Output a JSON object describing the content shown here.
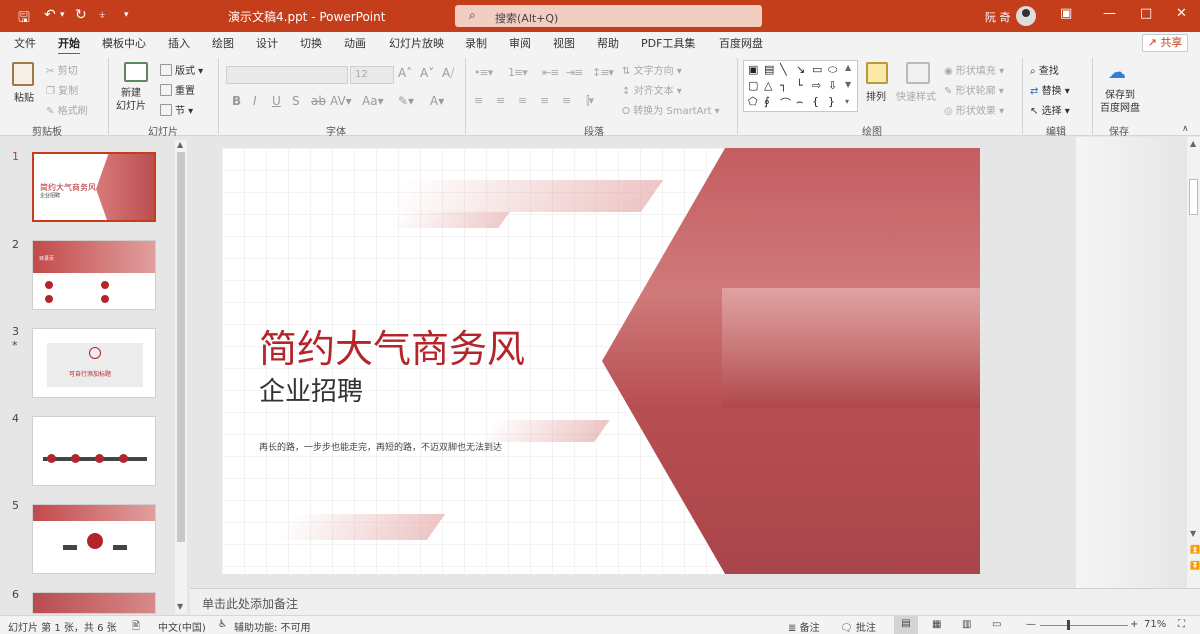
{
  "titlebar": {
    "doc_title": "演示文稿4.ppt - PowerPoint",
    "search_placeholder": "搜索(Alt+Q)",
    "user_name": "阮 奇",
    "accent": "#c43e1c"
  },
  "menu": {
    "tabs": [
      "文件",
      "开始",
      "模板中心",
      "插入",
      "绘图",
      "设计",
      "切换",
      "动画",
      "幻灯片放映",
      "录制",
      "审阅",
      "视图",
      "帮助",
      "PDF工具集",
      "百度网盘"
    ],
    "active": "开始",
    "share": "共享"
  },
  "ribbon": {
    "clipboard": {
      "label": "剪贴板",
      "paste": "粘贴",
      "cut": "剪切",
      "copy": "复制",
      "format_painter": "格式刷"
    },
    "slides": {
      "label": "幻灯片",
      "new_slide": "新建\n幻灯片",
      "layout": "版式",
      "reset": "重置",
      "section": "节"
    },
    "font": {
      "label": "字体",
      "size": "12"
    },
    "paragraph": {
      "label": "段落",
      "text_direction": "文字方向",
      "align_text": "对齐文本",
      "smartart": "转换为 SmartArt"
    },
    "drawing": {
      "label": "绘图",
      "arrange": "排列",
      "quick_styles": "快速样式",
      "shape_fill": "形状填充",
      "shape_outline": "形状轮廓",
      "shape_effects": "形状效果"
    },
    "editing": {
      "label": "编辑",
      "find": "查找",
      "replace": "替换",
      "select": "选择"
    },
    "save": {
      "label": "保存",
      "save_to_baidu": "保存到\n百度网盘"
    }
  },
  "thumbnails": [
    {
      "num": "1",
      "title": "简约大气商务风",
      "subtitle": "企业招聘"
    },
    {
      "num": "2",
      "title": "目录页"
    },
    {
      "num": "3",
      "star": "*",
      "title": "可自行添加标题"
    },
    {
      "num": "4"
    },
    {
      "num": "5"
    },
    {
      "num": "6"
    }
  ],
  "slide": {
    "title": "简约大气商务风",
    "subtitle": "企业招聘",
    "tagline": "再长的路，一步步也能走完，再短的路，不迈双脚也无法到达",
    "accent": "#b4252b"
  },
  "notes": {
    "placeholder": "单击此处添加备注"
  },
  "status": {
    "slide_info": "幻灯片 第 1 张，共 6 张",
    "language": "中文(中国)",
    "accessibility": "辅助功能: 不可用",
    "notes": "备注",
    "comments": "批注",
    "zoom": "71%"
  }
}
